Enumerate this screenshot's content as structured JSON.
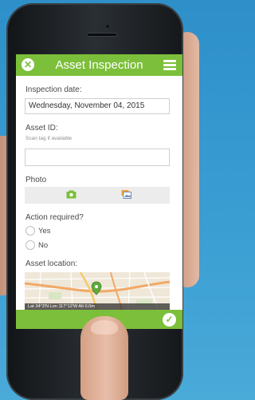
{
  "app": {
    "title": "Asset Inspection"
  },
  "fields": {
    "inspection_date_label": "Inspection date:",
    "inspection_date_value": "Wednesday, November 04, 2015",
    "asset_id_label": "Asset ID:",
    "asset_id_hint": "Scan tag if available",
    "asset_id_value": "",
    "photo_label": "Photo",
    "action_required_label": "Action required?",
    "yes_label": "Yes",
    "no_label": "No",
    "asset_location_label": "Asset location:",
    "coordinates": "Lat 34°3'N Lon 117°12'W Alt 0.0m"
  },
  "icons": {
    "close": "close-icon",
    "menu": "menu-icon",
    "camera": "camera-icon",
    "gallery": "gallery-icon",
    "pin": "map-pin-icon",
    "submit": "check-icon"
  },
  "colors": {
    "accent": "#7cbf3a",
    "background": "#3a9ed3"
  }
}
